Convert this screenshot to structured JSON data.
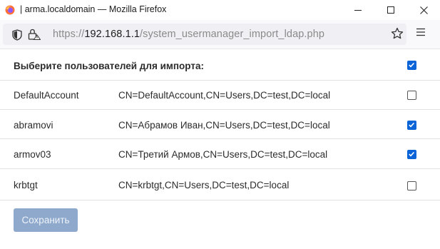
{
  "window": {
    "title": "| arma.localdomain — Mozilla Firefox"
  },
  "urlbar": {
    "prefix": "https://",
    "host": "192.168.1.1",
    "path": "/system_usermanager_import_ldap.php"
  },
  "form": {
    "header_label": "Выберите пользователей для импорта:",
    "header_checked": true,
    "users": [
      {
        "username": "DefaultAccount",
        "dn": "CN=DefaultAccount,CN=Users,DC=test,DC=local",
        "checked": false
      },
      {
        "username": "abramovi",
        "dn": "CN=Абрамов Иван,CN=Users,DC=test,DC=local",
        "checked": true
      },
      {
        "username": "armov03",
        "dn": "CN=Третий Армов,CN=Users,DC=test,DC=local",
        "checked": true
      },
      {
        "username": "krbtgt",
        "dn": "CN=krbtgt,CN=Users,DC=test,DC=local",
        "checked": false
      }
    ],
    "save_label": "Сохранить"
  },
  "colors": {
    "checkbox_checked": "#0a64d8",
    "save_button": "#8fa9cc"
  }
}
